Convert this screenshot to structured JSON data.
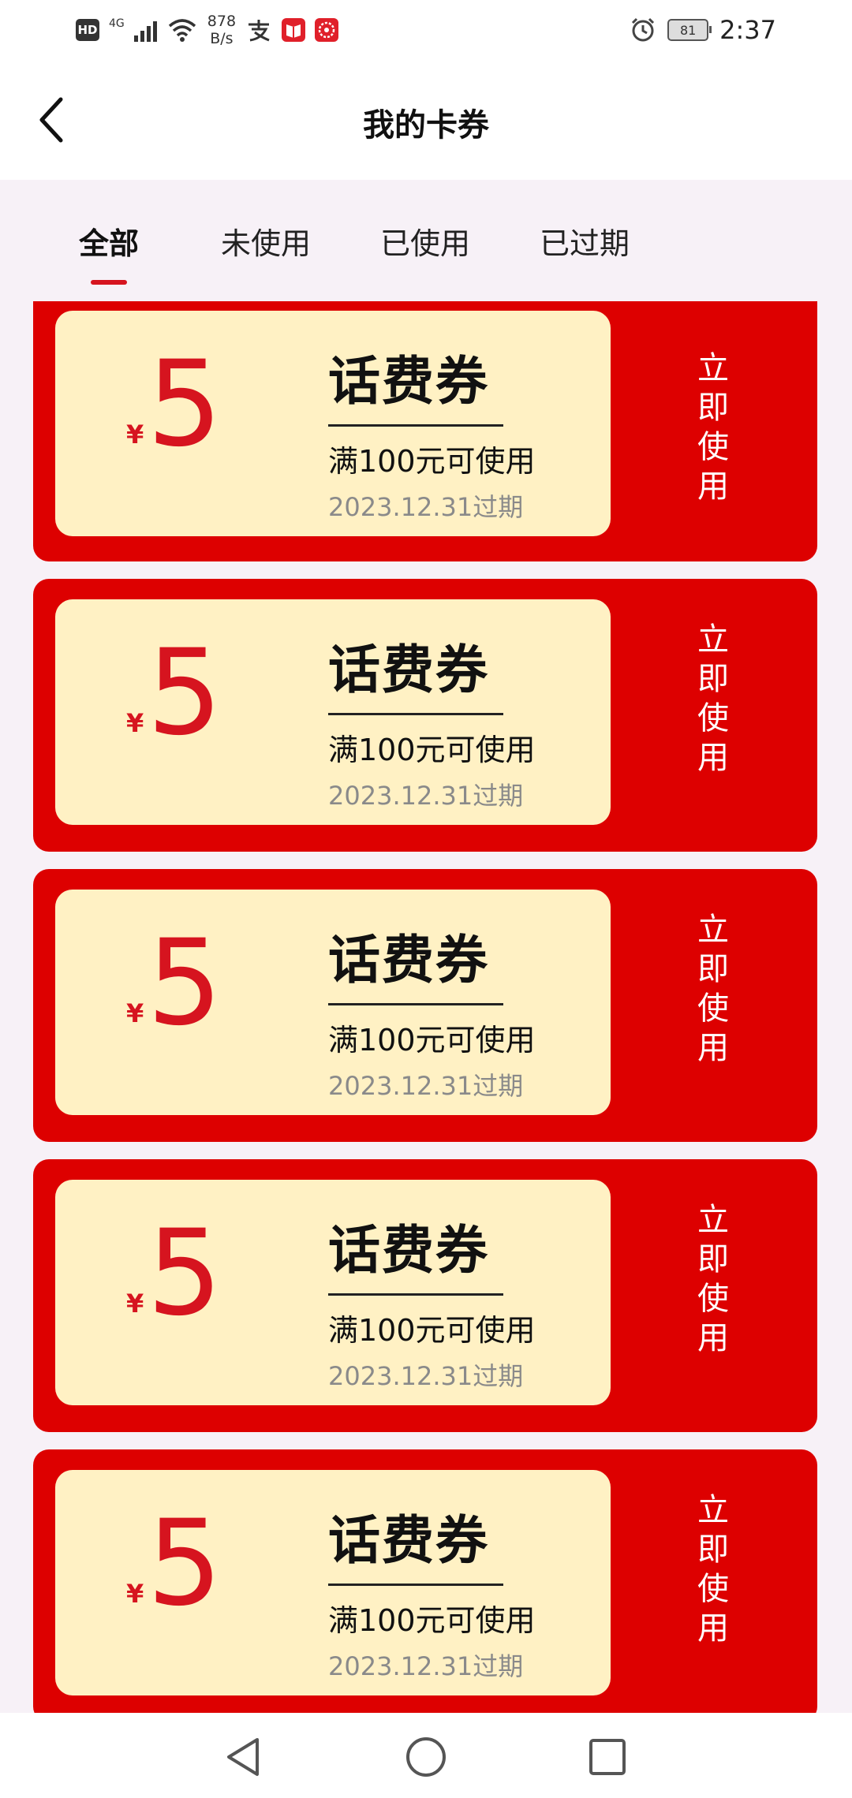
{
  "status_bar": {
    "hd": "HD",
    "network": "4G",
    "speed_value": "878",
    "speed_unit": "B/s",
    "battery": "81",
    "time": "2:37"
  },
  "nav": {
    "title": "我的卡券",
    "back_icon": "chevron-left-icon"
  },
  "tabs": [
    {
      "label": "全部",
      "active": true
    },
    {
      "label": "未使用",
      "active": false
    },
    {
      "label": "已使用",
      "active": false
    },
    {
      "label": "已过期",
      "active": false
    }
  ],
  "coupons": [
    {
      "currency": "¥",
      "amount": "5",
      "title": "话费券",
      "condition": "满100元可使用",
      "expiry": "2023.12.31过期",
      "action": "立即使用"
    },
    {
      "currency": "¥",
      "amount": "5",
      "title": "话费券",
      "condition": "满100元可使用",
      "expiry": "2023.12.31过期",
      "action": "立即使用"
    },
    {
      "currency": "¥",
      "amount": "5",
      "title": "话费券",
      "condition": "满100元可使用",
      "expiry": "2023.12.31过期",
      "action": "立即使用"
    },
    {
      "currency": "¥",
      "amount": "5",
      "title": "话费券",
      "condition": "满100元可使用",
      "expiry": "2023.12.31过期",
      "action": "立即使用"
    },
    {
      "currency": "¥",
      "amount": "5",
      "title": "话费券",
      "condition": "满100元可使用",
      "expiry": "2023.12.31过期",
      "action": "立即使用"
    }
  ],
  "bottom_nav": [
    "back-triangle-icon",
    "home-circle-icon",
    "recents-square-icon"
  ],
  "colors": {
    "accent_red": "#dd0000",
    "coupon_bg": "#fff1c4",
    "page_bg": "#f7f1f7"
  }
}
